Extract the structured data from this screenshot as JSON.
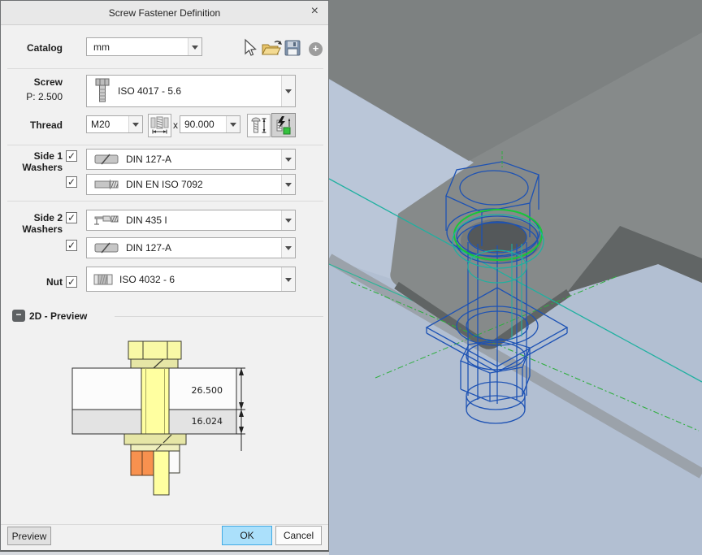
{
  "window": {
    "title": "Screw Fastener Definition",
    "close_glyph": "×"
  },
  "toolbar": {
    "catalog_label": "Catalog",
    "catalog_value": "mm"
  },
  "screw": {
    "label": "Screw",
    "pitch": "P: 2.500",
    "standard": "ISO 4017 - 5.6"
  },
  "thread": {
    "label": "Thread",
    "size": "M20",
    "multiply_glyph": "x",
    "length": "90.000"
  },
  "side1": {
    "line1": "Side 1",
    "line2": "Washers",
    "washer1": "DIN 127-A",
    "washer2": "DIN EN ISO 7092"
  },
  "side2": {
    "line1": "Side 2",
    "line2": "Washers",
    "washer1": "DIN 435 I",
    "washer2": "DIN 127-A"
  },
  "nut": {
    "label": "Nut",
    "standard": "ISO 4032 - 6"
  },
  "preview2d": {
    "label": "2D - Preview",
    "collapse_glyph": "−",
    "dim_upper": "26.500",
    "dim_lower": "16.024"
  },
  "footer": {
    "preview": "Preview",
    "ok": "OK",
    "cancel": "Cancel"
  },
  "glyphs": {
    "check": "✓"
  },
  "colors": {
    "ok_fill": "#abe0fb",
    "ok_border": "#42aae4",
    "wireframe_blue": "#1d52b4",
    "washer_highlight_green": "#17c837",
    "sketch_teal": "#1fb0a0",
    "plate_blue": "#b2bfd2",
    "plate_gray": "#868a8a",
    "section_orange": "#f8914f",
    "section_yellow": "#ffffa0"
  }
}
